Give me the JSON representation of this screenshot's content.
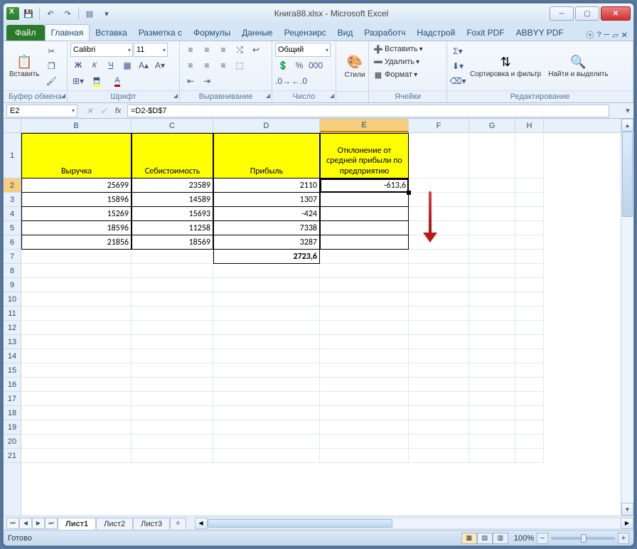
{
  "window": {
    "title": "Книга88.xlsx - Microsoft Excel"
  },
  "tabs": {
    "file": "Файл",
    "items": [
      "Главная",
      "Вставка",
      "Разметка с",
      "Формулы",
      "Данные",
      "Рецензирс",
      "Вид",
      "Разработч",
      "Надстрой",
      "Foxit PDF",
      "ABBYY PDF"
    ],
    "active": 0
  },
  "ribbon": {
    "clipboard": {
      "paste": "Вставить",
      "label": "Буфер обмена"
    },
    "font": {
      "name": "Calibri",
      "size": "11",
      "label": "Шрифт"
    },
    "alignment": {
      "label": "Выравнивание"
    },
    "number": {
      "format": "Общий",
      "label": "Число"
    },
    "styles": {
      "btn": "Стили"
    },
    "cells": {
      "insert": "Вставить",
      "delete": "Удалить",
      "format": "Формат",
      "label": "Ячейки"
    },
    "editing": {
      "sort": "Сортировка и фильтр",
      "find": "Найти и выделить",
      "label": "Редактирование"
    }
  },
  "formula_bar": {
    "name_box": "E2",
    "fx": "fx",
    "formula": "=D2-$D$7"
  },
  "columns": [
    "B",
    "C",
    "D",
    "E",
    "F",
    "G",
    "H"
  ],
  "row_numbers": [
    1,
    2,
    3,
    4,
    5,
    6,
    7,
    8,
    9,
    10,
    11,
    12,
    13,
    14,
    15,
    16,
    17,
    18,
    19,
    20,
    21
  ],
  "headers": {
    "B": "Выручка",
    "C": "Себистоимость",
    "D": "Прибыль",
    "E": "Отклонение от средней прибыли по предприятию"
  },
  "chart_data": {
    "type": "table",
    "columns": [
      "Выручка",
      "Себистоимость",
      "Прибыль",
      "Отклонение от средней прибыли по предприятию"
    ],
    "rows": [
      {
        "B": "25699",
        "C": "23589",
        "D": "2110",
        "E": "-613,6"
      },
      {
        "B": "15896",
        "C": "14589",
        "D": "1307",
        "E": ""
      },
      {
        "B": "15269",
        "C": "15693",
        "D": "-424",
        "E": ""
      },
      {
        "B": "18596",
        "C": "11258",
        "D": "7338",
        "E": ""
      },
      {
        "B": "21856",
        "C": "18569",
        "D": "3287",
        "E": ""
      }
    ],
    "summary": {
      "D": "2723,6"
    }
  },
  "sheets": {
    "items": [
      "Лист1",
      "Лист2",
      "Лист3"
    ],
    "active": 0
  },
  "status": {
    "ready": "Готово",
    "zoom": "100%"
  }
}
